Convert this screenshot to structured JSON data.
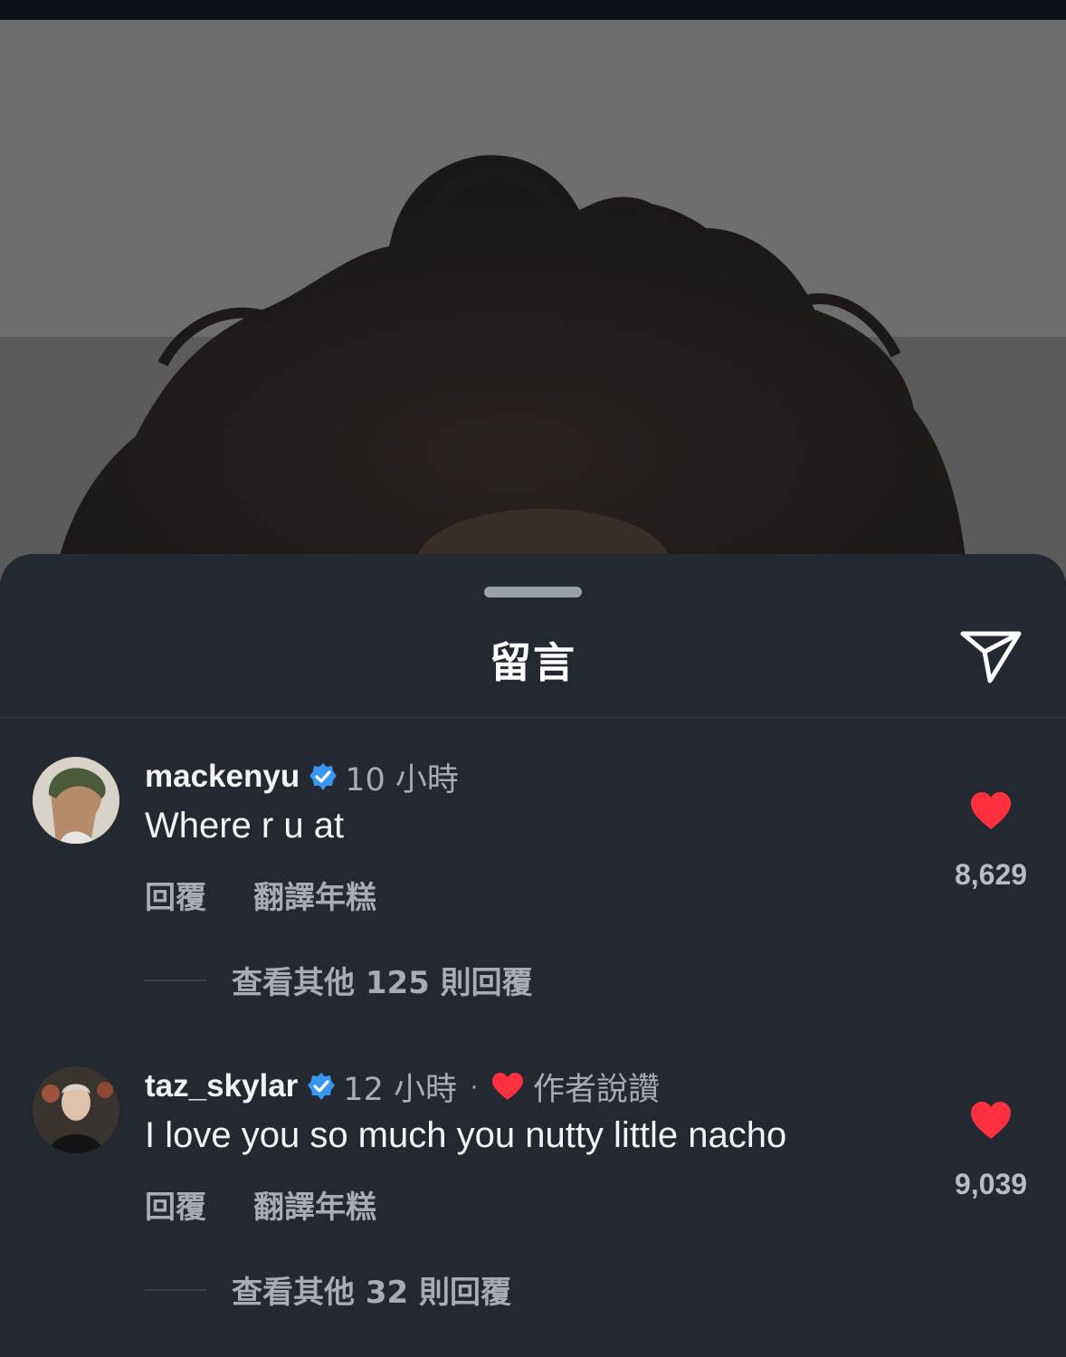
{
  "header": {
    "title": "留言",
    "share_icon": "paper-plane-icon"
  },
  "comments": [
    {
      "username": "mackenyu",
      "verified": true,
      "time": "10 小時",
      "text": "Where r u at",
      "reply_label": "回覆",
      "translate_label": "翻譯年糕",
      "like_count": "8,629",
      "view_replies_label": "查看其他 125 則回覆",
      "liked_by_author": false
    },
    {
      "username": "taz_skylar",
      "verified": true,
      "time": "12 小時",
      "separator": "·",
      "liked_by_author_label": "作者說讚",
      "text": "I love you so much you nutty little nacho",
      "reply_label": "回覆",
      "translate_label": "翻譯年糕",
      "like_count": "9,039",
      "view_replies_label": "查看其他 32 則回覆",
      "liked_by_author": true
    }
  ],
  "colors": {
    "sheet_background": "#242831",
    "heart_red": "#ff3040",
    "verified_blue": "#3897f0",
    "secondary_text": "#a8acb4"
  }
}
